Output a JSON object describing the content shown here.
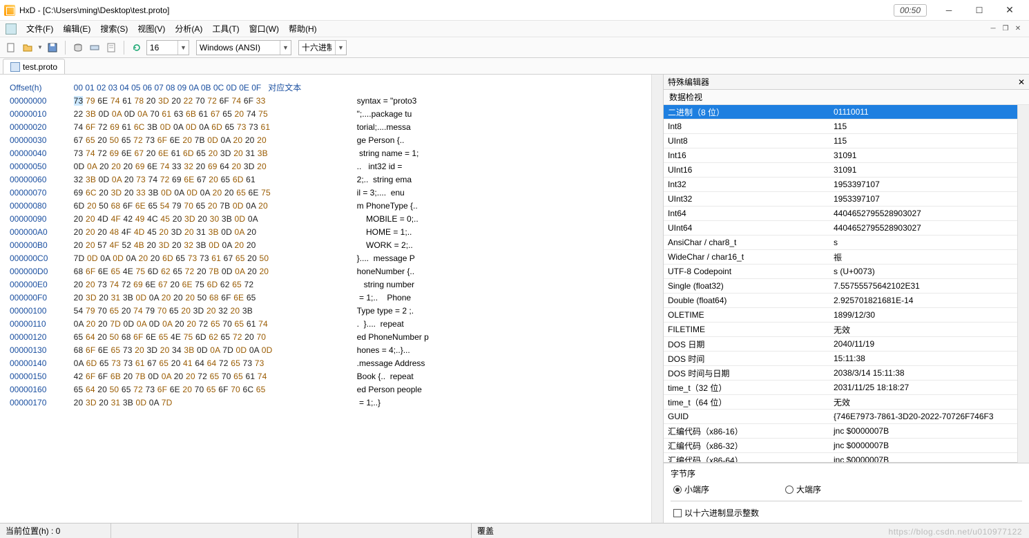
{
  "window": {
    "title": "HxD - [C:\\Users\\ming\\Desktop\\test.proto]",
    "clock": "00:50"
  },
  "menus": [
    "文件(F)",
    "编辑(E)",
    "搜索(S)",
    "视图(V)",
    "分析(A)",
    "工具(T)",
    "窗口(W)",
    "帮助(H)"
  ],
  "toolbar": {
    "columns": "16",
    "encoding": "Windows (ANSI)",
    "base": "十六进制"
  },
  "tab": {
    "name": "test.proto"
  },
  "header": {
    "offset": "Offset(h)",
    "cols": "00 01 02 03 04 05 06 07 08 09 0A 0B 0C 0D 0E 0F",
    "text": "对应文本"
  },
  "rows": [
    {
      "o": "00000000",
      "b": [
        "73",
        "79",
        "6E",
        "74",
        "61",
        "78",
        "20",
        "3D",
        "20",
        "22",
        "70",
        "72",
        "6F",
        "74",
        "6F",
        "33"
      ],
      "t": "syntax = \"proto3"
    },
    {
      "o": "00000010",
      "b": [
        "22",
        "3B",
        "0D",
        "0A",
        "0D",
        "0A",
        "70",
        "61",
        "63",
        "6B",
        "61",
        "67",
        "65",
        "20",
        "74",
        "75"
      ],
      "t": "\";....package tu"
    },
    {
      "o": "00000020",
      "b": [
        "74",
        "6F",
        "72",
        "69",
        "61",
        "6C",
        "3B",
        "0D",
        "0A",
        "0D",
        "0A",
        "6D",
        "65",
        "73",
        "73",
        "61"
      ],
      "t": "torial;....messa"
    },
    {
      "o": "00000030",
      "b": [
        "67",
        "65",
        "20",
        "50",
        "65",
        "72",
        "73",
        "6F",
        "6E",
        "20",
        "7B",
        "0D",
        "0A",
        "20",
        "20",
        "20"
      ],
      "t": "ge Person {..   "
    },
    {
      "o": "00000040",
      "b": [
        "73",
        "74",
        "72",
        "69",
        "6E",
        "67",
        "20",
        "6E",
        "61",
        "6D",
        "65",
        "20",
        "3D",
        "20",
        "31",
        "3B"
      ],
      "t": " string name = 1;"
    },
    {
      "o": "00000050",
      "b": [
        "0D",
        "0A",
        "20",
        "20",
        "20",
        "69",
        "6E",
        "74",
        "33",
        "32",
        "20",
        "69",
        "64",
        "20",
        "3D",
        "20"
      ],
      "t": "..   int32 id = "
    },
    {
      "o": "00000060",
      "b": [
        "32",
        "3B",
        "0D",
        "0A",
        "20",
        "73",
        "74",
        "72",
        "69",
        "6E",
        "67",
        "20",
        "65",
        "6D",
        "61",
        ""
      ],
      "t": "2;..  string ema"
    },
    {
      "o": "00000070",
      "b": [
        "69",
        "6C",
        "20",
        "3D",
        "20",
        "33",
        "3B",
        "0D",
        "0A",
        "0D",
        "0A",
        "20",
        "20",
        "65",
        "6E",
        "75"
      ],
      "t": "il = 3;....  enu"
    },
    {
      "o": "00000080",
      "b": [
        "6D",
        "20",
        "50",
        "68",
        "6F",
        "6E",
        "65",
        "54",
        "79",
        "70",
        "65",
        "20",
        "7B",
        "0D",
        "0A",
        "20"
      ],
      "t": "m PhoneType {.. "
    },
    {
      "o": "00000090",
      "b": [
        "20",
        "20",
        "4D",
        "4F",
        "42",
        "49",
        "4C",
        "45",
        "20",
        "3D",
        "20",
        "30",
        "3B",
        "0D",
        "0A",
        ""
      ],
      "t": "    MOBILE = 0;.."
    },
    {
      "o": "000000A0",
      "b": [
        "20",
        "20",
        "20",
        "48",
        "4F",
        "4D",
        "45",
        "20",
        "3D",
        "20",
        "31",
        "3B",
        "0D",
        "0A",
        "20",
        ""
      ],
      "t": "    HOME = 1;.."
    },
    {
      "o": "000000B0",
      "b": [
        "20",
        "20",
        "57",
        "4F",
        "52",
        "4B",
        "20",
        "3D",
        "20",
        "32",
        "3B",
        "0D",
        "0A",
        "20",
        "20",
        ""
      ],
      "t": "    WORK = 2;.."
    },
    {
      "o": "000000C0",
      "b": [
        "7D",
        "0D",
        "0A",
        "0D",
        "0A",
        "20",
        "20",
        "6D",
        "65",
        "73",
        "73",
        "61",
        "67",
        "65",
        "20",
        "50"
      ],
      "t": "}....  message P"
    },
    {
      "o": "000000D0",
      "b": [
        "68",
        "6F",
        "6E",
        "65",
        "4E",
        "75",
        "6D",
        "62",
        "65",
        "72",
        "20",
        "7B",
        "0D",
        "0A",
        "20",
        "20"
      ],
      "t": "honeNumber {.."
    },
    {
      "o": "000000E0",
      "b": [
        "20",
        "20",
        "73",
        "74",
        "72",
        "69",
        "6E",
        "67",
        "20",
        "6E",
        "75",
        "6D",
        "62",
        "65",
        "72",
        ""
      ],
      "t": "   string number"
    },
    {
      "o": "000000F0",
      "b": [
        "20",
        "3D",
        "20",
        "31",
        "3B",
        "0D",
        "0A",
        "20",
        "20",
        "20",
        "50",
        "68",
        "6F",
        "6E",
        "65",
        ""
      ],
      "t": " = 1;..    Phone"
    },
    {
      "o": "00000100",
      "b": [
        "54",
        "79",
        "70",
        "65",
        "20",
        "74",
        "79",
        "70",
        "65",
        "20",
        "3D",
        "20",
        "32",
        "20",
        "3B",
        ""
      ],
      "t": "Type type = 2 ;."
    },
    {
      "o": "00000110",
      "b": [
        "0A",
        "20",
        "20",
        "7D",
        "0D",
        "0A",
        "0D",
        "0A",
        "20",
        "20",
        "72",
        "65",
        "70",
        "65",
        "61",
        "74"
      ],
      "t": ".  }....  repeat"
    },
    {
      "o": "00000120",
      "b": [
        "65",
        "64",
        "20",
        "50",
        "68",
        "6F",
        "6E",
        "65",
        "4E",
        "75",
        "6D",
        "62",
        "65",
        "72",
        "20",
        "70"
      ],
      "t": "ed PhoneNumber p"
    },
    {
      "o": "00000130",
      "b": [
        "68",
        "6F",
        "6E",
        "65",
        "73",
        "20",
        "3D",
        "20",
        "34",
        "3B",
        "0D",
        "0A",
        "7D",
        "0D",
        "0A",
        "0D"
      ],
      "t": "hones = 4;..}..."
    },
    {
      "o": "00000140",
      "b": [
        "0A",
        "6D",
        "65",
        "73",
        "73",
        "61",
        "67",
        "65",
        "20",
        "41",
        "64",
        "64",
        "72",
        "65",
        "73",
        "73"
      ],
      "t": ".message Address"
    },
    {
      "o": "00000150",
      "b": [
        "42",
        "6F",
        "6F",
        "6B",
        "20",
        "7B",
        "0D",
        "0A",
        "20",
        "20",
        "72",
        "65",
        "70",
        "65",
        "61",
        "74"
      ],
      "t": "Book {..  repeat"
    },
    {
      "o": "00000160",
      "b": [
        "65",
        "64",
        "20",
        "50",
        "65",
        "72",
        "73",
        "6F",
        "6E",
        "20",
        "70",
        "65",
        "6F",
        "70",
        "6C",
        "65"
      ],
      "t": "ed Person people"
    },
    {
      "o": "00000170",
      "b": [
        "20",
        "3D",
        "20",
        "31",
        "3B",
        "0D",
        "0A",
        "7D",
        "",
        "",
        "",
        "",
        "",
        "",
        "",
        ""
      ],
      "t": " = 1;..}"
    }
  ],
  "inspector": {
    "title": "特殊编辑器",
    "subtitle": "数据检视",
    "rows": [
      {
        "k": "二进制（8 位）",
        "v": "01110011",
        "sel": true
      },
      {
        "k": "Int8",
        "v": "115"
      },
      {
        "k": "UInt8",
        "v": "115"
      },
      {
        "k": "Int16",
        "v": "31091"
      },
      {
        "k": "UInt16",
        "v": "31091"
      },
      {
        "k": "Int32",
        "v": "1953397107"
      },
      {
        "k": "UInt32",
        "v": "1953397107"
      },
      {
        "k": "Int64",
        "v": "4404652795528903027"
      },
      {
        "k": "UInt64",
        "v": "4404652795528903027"
      },
      {
        "k": "AnsiChar / char8_t",
        "v": "s"
      },
      {
        "k": "WideChar / char16_t",
        "v": "祳"
      },
      {
        "k": "UTF-8 Codepoint",
        "v": "s (U+0073)"
      },
      {
        "k": "Single (float32)",
        "v": "7.55755575642102E31"
      },
      {
        "k": "Double (float64)",
        "v": "2.925701821681E-14"
      },
      {
        "k": "OLETIME",
        "v": "1899/12/30"
      },
      {
        "k": "FILETIME",
        "v": "无效"
      },
      {
        "k": "DOS 日期",
        "v": "2040/11/19"
      },
      {
        "k": "DOS 时间",
        "v": "15:11:38"
      },
      {
        "k": "DOS 时间与日期",
        "v": "2038/3/14 15:11:38"
      },
      {
        "k": "time_t（32 位）",
        "v": "2031/11/25 18:18:27"
      },
      {
        "k": "time_t（64 位）",
        "v": "无效"
      },
      {
        "k": "GUID",
        "v": "{746E7973-7861-3D20-2022-70726F746F3"
      },
      {
        "k": "汇编代码（x86-16）",
        "v": "jnc $0000007B"
      },
      {
        "k": "汇编代码（x86-32）",
        "v": "jnc $0000007B"
      },
      {
        "k": "汇编代码（x86-64）",
        "v": "jnc $0000007B"
      }
    ],
    "byteorder_label": "字节序",
    "endian_le": "小端序",
    "endian_be": "大端序",
    "hex_check": "以十六进制显示整数"
  },
  "status": {
    "pos": "当前位置(h) : 0",
    "mode": "覆盖"
  },
  "watermark": "https://blog.csdn.net/u010977122"
}
